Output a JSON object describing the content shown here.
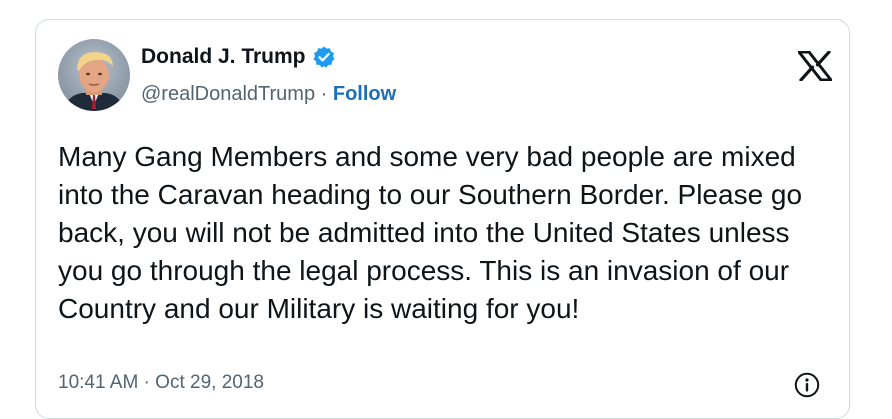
{
  "author": {
    "name": "Donald J. Trump",
    "handle": "@realDonaldTrump",
    "separator": " · ",
    "follow_label": "Follow",
    "verified_color": "#1d9bf0"
  },
  "icons": {
    "logo": "x-logo-icon",
    "verified": "verified-badge-icon",
    "info": "info-icon"
  },
  "tweet": {
    "text": "Many Gang Members and some very bad people are mixed into the Caravan heading to our Southern Border. Please go back, you will not be admitted into the United States unless you go through the legal process. This is an invasion of our Country and our Military is waiting for you!",
    "timestamp": "10:41 AM · Oct 29, 2018"
  }
}
